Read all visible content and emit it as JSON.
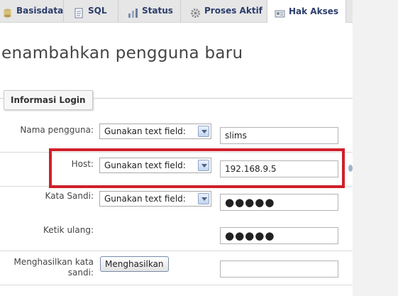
{
  "tabs": [
    {
      "label": "Basisdata",
      "icon": "database-icon",
      "active": false
    },
    {
      "label": "SQL",
      "icon": "sql-icon",
      "active": false
    },
    {
      "label": "Status",
      "icon": "status-icon",
      "active": false
    },
    {
      "label": "Proses Aktif",
      "icon": "gear-icon",
      "active": false
    },
    {
      "label": "Hak Akses",
      "icon": "users-icon",
      "active": true
    }
  ],
  "page_title": "enambahkan pengguna baru",
  "legend": "Informasi Login",
  "form": {
    "username": {
      "label": "Nama pengguna:",
      "select": "Gunakan text field:",
      "value": "slims"
    },
    "host": {
      "label": "Host:",
      "select": "Gunakan text field:",
      "value": "192.168.9.5"
    },
    "password": {
      "label": "Kata Sandi:",
      "select": "Gunakan text field:",
      "value": "●●●●●"
    },
    "retype": {
      "label": "Ketik ulang:",
      "value": "●●●●●"
    },
    "generate": {
      "label_line1": "Menghasilkan kata",
      "label_line2": "sandi:",
      "button": "Menghasilkan",
      "value": ""
    }
  },
  "colors": {
    "highlight": "#d0202a",
    "tab_text": "#2b3d6b"
  }
}
